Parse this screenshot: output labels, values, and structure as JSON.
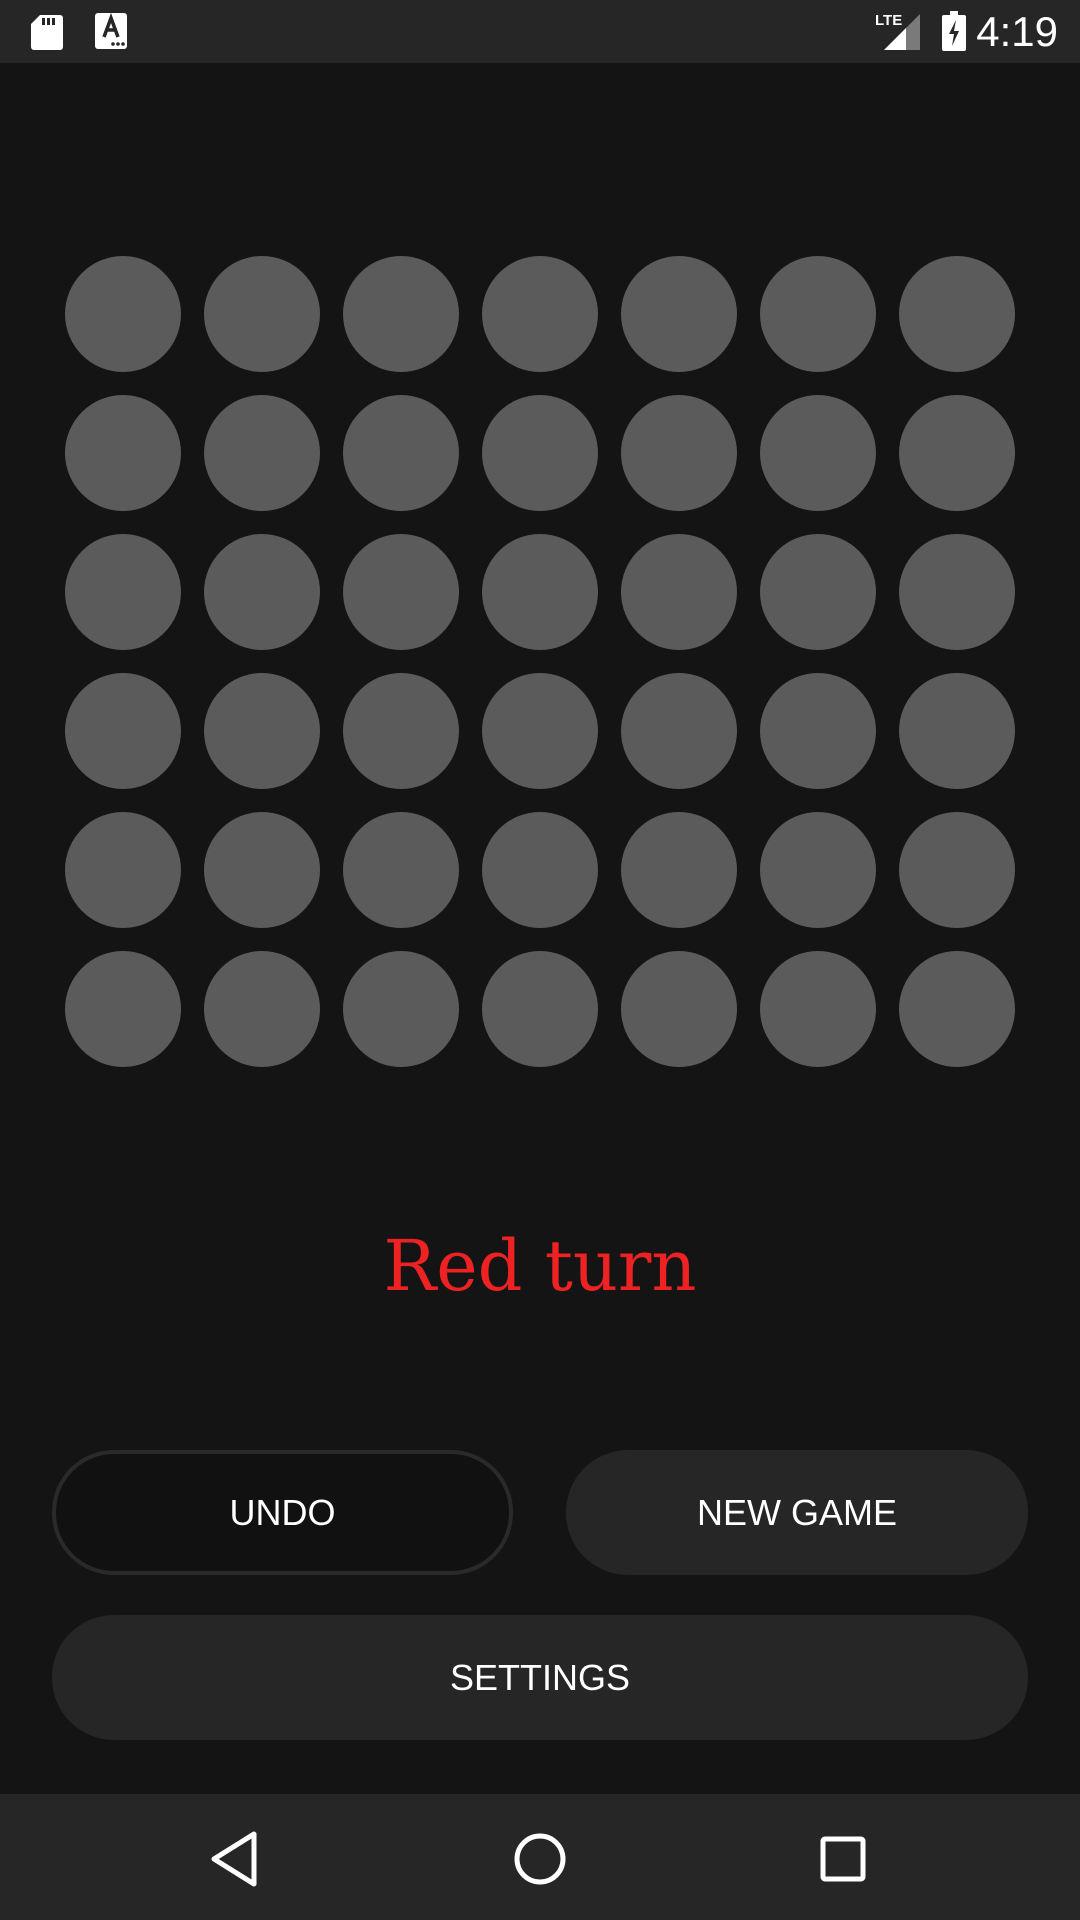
{
  "status_bar": {
    "time": "4:19",
    "network_label": "LTE",
    "icons": [
      "sd-card-icon",
      "font-download-icon",
      "signal-icon",
      "battery-charging-icon"
    ]
  },
  "board": {
    "rows": 6,
    "columns": 7,
    "empty_color": "#5b5b5b",
    "cells": [
      [
        "empty",
        "empty",
        "empty",
        "empty",
        "empty",
        "empty",
        "empty"
      ],
      [
        "empty",
        "empty",
        "empty",
        "empty",
        "empty",
        "empty",
        "empty"
      ],
      [
        "empty",
        "empty",
        "empty",
        "empty",
        "empty",
        "empty",
        "empty"
      ],
      [
        "empty",
        "empty",
        "empty",
        "empty",
        "empty",
        "empty",
        "empty"
      ],
      [
        "empty",
        "empty",
        "empty",
        "empty",
        "empty",
        "empty",
        "empty"
      ],
      [
        "empty",
        "empty",
        "empty",
        "empty",
        "empty",
        "empty",
        "empty"
      ]
    ]
  },
  "turn": {
    "text": "Red turn",
    "color": "#ee2222"
  },
  "buttons": {
    "undo": "UNDO",
    "new_game": "NEW GAME",
    "settings": "SETTINGS"
  },
  "nav_bar": {
    "icons": [
      "back-icon",
      "home-icon",
      "recents-icon"
    ]
  }
}
